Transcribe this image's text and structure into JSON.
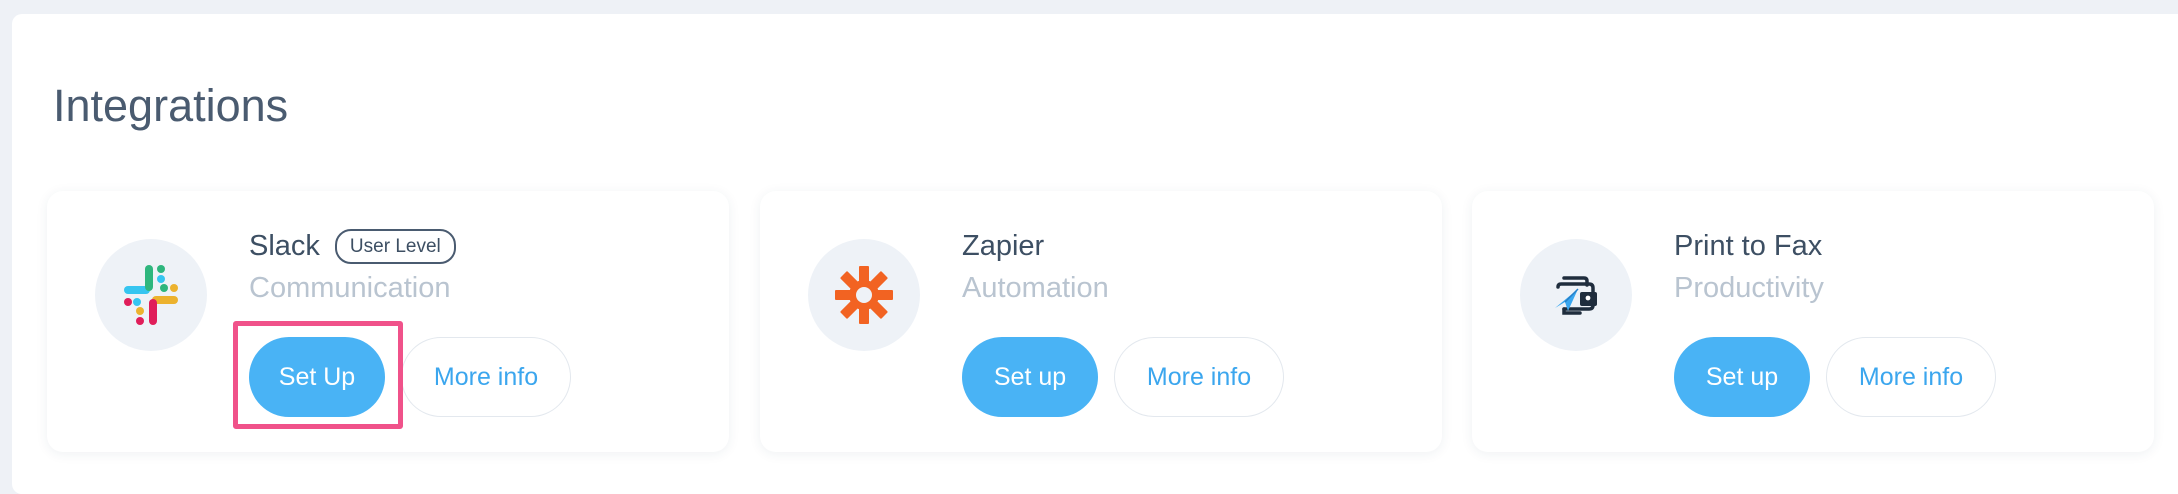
{
  "section": {
    "title": "Integrations"
  },
  "cards": [
    {
      "name": "Slack",
      "badge": "User Level",
      "category": "Communication",
      "setup_label": "Set Up",
      "more_label": "More info",
      "icon": "slack-logo-icon"
    },
    {
      "name": "Zapier",
      "category": "Automation",
      "setup_label": "Set up",
      "more_label": "More info",
      "icon": "zapier-logo-icon"
    },
    {
      "name": "Print to Fax",
      "category": "Productivity",
      "setup_label": "Set up",
      "more_label": "More info",
      "icon": "print-to-fax-icon"
    }
  ],
  "colors": {
    "accent": "#49b3f5",
    "highlight": "#f0528a",
    "zapier": "#f26322"
  }
}
